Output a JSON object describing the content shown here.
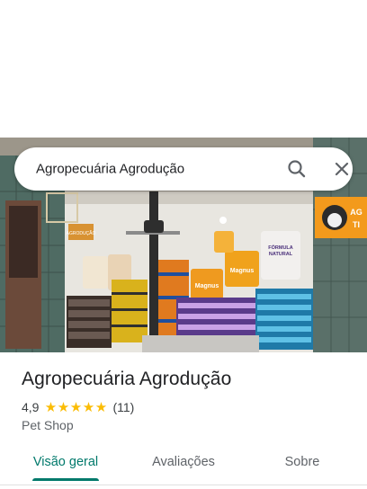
{
  "search": {
    "query": "Agropecuária Agrodução",
    "search_icon": "search-icon",
    "close_icon": "close-icon"
  },
  "hero_photo": {
    "signage": [
      "AGRODUÇÃO",
      "Magnus",
      "FÓRMULA NATURAL",
      "AG",
      "TI"
    ]
  },
  "place": {
    "name": "Agropecuária Agrodução",
    "rating": "4,9",
    "stars": 5,
    "review_count": "(11)",
    "category": "Pet Shop"
  },
  "tabs": [
    {
      "label": "Visão geral",
      "active": true
    },
    {
      "label": "Avaliações",
      "active": false
    },
    {
      "label": "Sobre",
      "active": false
    }
  ],
  "colors": {
    "accent": "#00796b",
    "star": "#fbbc04"
  }
}
